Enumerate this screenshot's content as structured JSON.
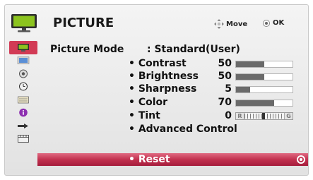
{
  "header": {
    "title": "PICTURE",
    "move_label": "Move",
    "ok_label": "OK",
    "tv_icon": "tv-icon",
    "move_icon": "four-arrow-move-icon",
    "ok_icon": "ok-button-icon"
  },
  "sidebar": {
    "items": [
      {
        "name": "picture-icon",
        "color": "#6fa01a"
      },
      {
        "name": "screen-icon",
        "color": "#3f78c4"
      },
      {
        "name": "audio-icon",
        "color": "#444444"
      },
      {
        "name": "time-icon",
        "color": "#444444"
      },
      {
        "name": "option-icon",
        "color": "#444444"
      },
      {
        "name": "info-icon",
        "color": "#7a2a9a"
      },
      {
        "name": "input-icon",
        "color": "#444444"
      },
      {
        "name": "media-icon",
        "color": "#444444"
      }
    ]
  },
  "menu": {
    "mode_label": "Picture Mode",
    "mode_value": ": Standard(User)",
    "items": [
      {
        "label": "• Contrast",
        "value": "50",
        "level": 0.5
      },
      {
        "label": "• Brightness",
        "value": "50",
        "level": 0.5
      },
      {
        "label": "• Sharpness",
        "value": "5",
        "level": 0.25
      },
      {
        "label": "• Color",
        "value": "70",
        "level": 0.68
      }
    ],
    "tint": {
      "label": "• Tint",
      "value": "0",
      "left": "R",
      "right": "G"
    },
    "advanced": {
      "label": "• Advanced Control"
    },
    "reset": {
      "label": "• Reset",
      "color": "#c2314f"
    }
  }
}
